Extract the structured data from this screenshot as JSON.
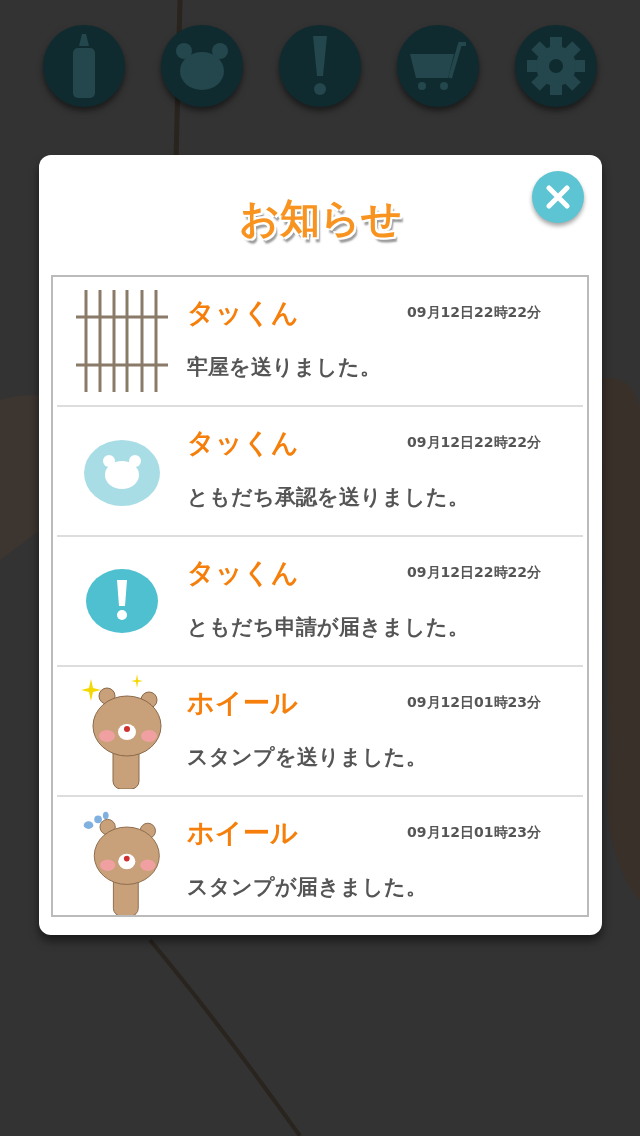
{
  "nav_buttons": [
    {
      "kind": "bottle"
    },
    {
      "kind": "bear"
    },
    {
      "kind": "alert"
    },
    {
      "kind": "cart"
    },
    {
      "kind": "gear"
    }
  ],
  "dialog": {
    "title": "お知らせ",
    "notifications": [
      {
        "kind": "bars",
        "name": "タッくん",
        "time": "09月12日22時22分",
        "message": "牢屋を送りました。"
      },
      {
        "kind": "bear-button",
        "name": "タッくん",
        "time": "09月12日22時22分",
        "message": "ともだち承認を送りました。"
      },
      {
        "kind": "alert-button",
        "name": "タッくん",
        "time": "09月12日22時22分",
        "message": "ともだち申請が届きました。"
      },
      {
        "kind": "bear-sparkle",
        "name": "ホイール",
        "time": "09月12日01時23分",
        "message": "スタンプを送りました。"
      },
      {
        "kind": "bear-sweat",
        "name": "ホイール",
        "time": "09月12日01時23分",
        "message": "スタンプが届きました。"
      }
    ]
  }
}
